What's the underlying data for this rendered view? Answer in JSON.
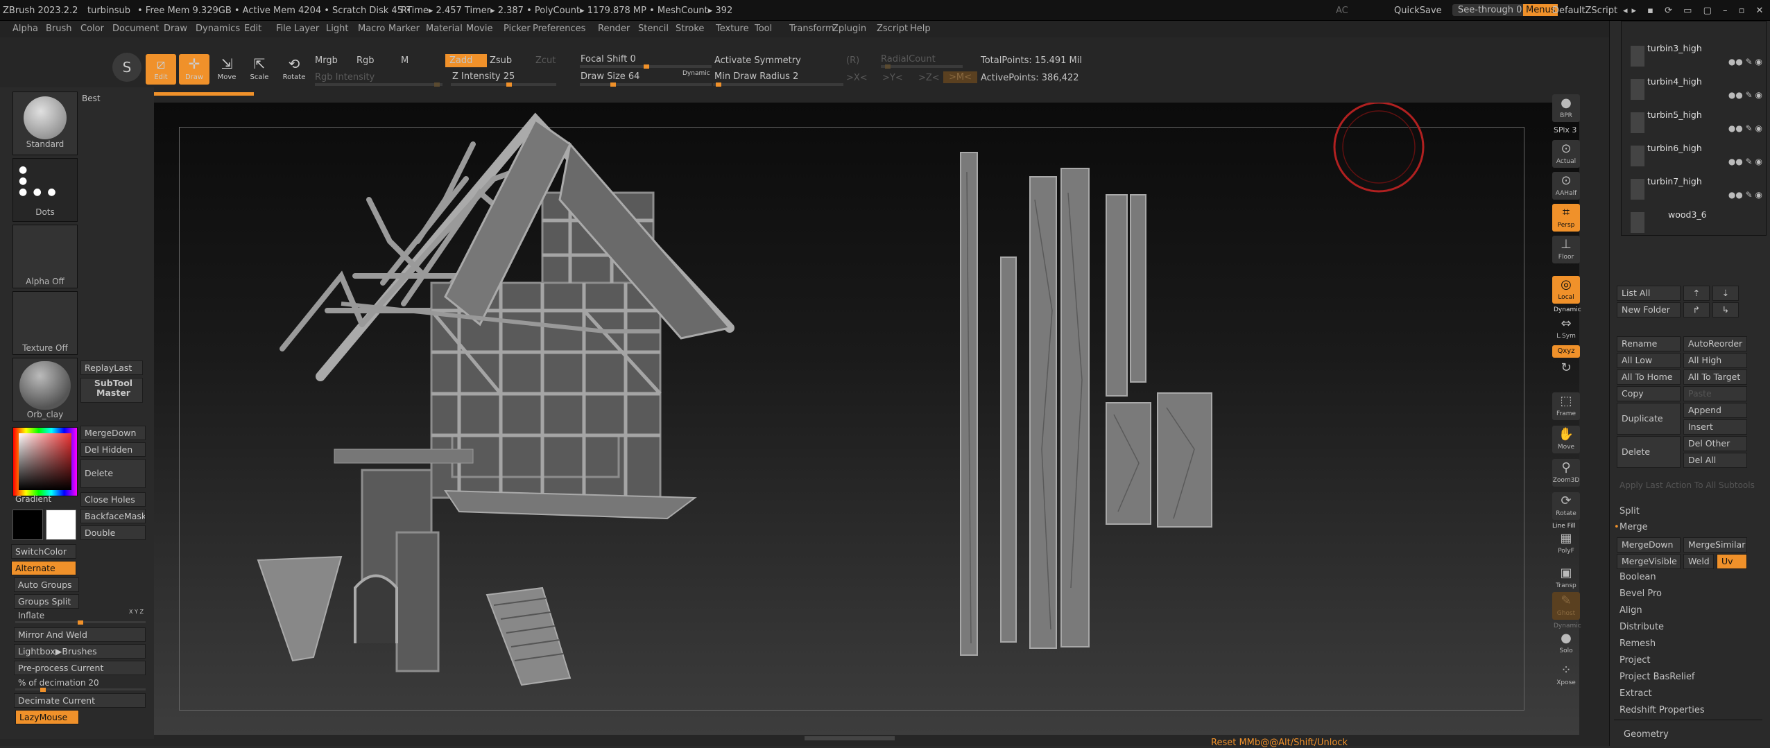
{
  "title": {
    "app": "ZBrush 2023.2.2",
    "doc": "turbinsub",
    "stats": "• Free Mem 9.329GB • Active Mem 4204 • Scratch Disk 45 •",
    "timer": "RTime▸ 2.457 Timer▸ 2.387 • PolyCount▸ 1179.878 MP • MeshCount▸ 392",
    "ac": "AC",
    "quicksave": "QuickSave",
    "seethrough": "See-through  0",
    "menus": "Menus",
    "script": "DefaultZScript"
  },
  "menus": [
    "Alpha",
    "Brush",
    "Color",
    "Document",
    "Draw",
    "Dynamics",
    "Edit",
    "File",
    "Layer",
    "Light",
    "Macro",
    "Marker",
    "Material",
    "Movie",
    "Picker",
    "Preferences",
    "Render",
    "Stencil",
    "Stroke",
    "Texture",
    "Tool",
    "Transform",
    "Zplugin",
    "Zscript",
    "Help"
  ],
  "toolbar": {
    "edit": "Edit",
    "draw": "Draw",
    "move": "Move",
    "scale": "Scale",
    "rotate": "Rotate",
    "mrgb": "Mrgb",
    "rgb": "Rgb",
    "m": "M",
    "rgb_intensity": "Rgb Intensity",
    "zadd": "Zadd",
    "zsub": "Zsub",
    "zcut": "Zcut",
    "z_intensity": "Z Intensity 25",
    "focal_shift": "Focal Shift 0",
    "draw_size": "Draw Size 64",
    "dynamic": "Dynamic",
    "activate_symmetry": "Activate Symmetry",
    "r": "(R)",
    "min_draw_radius": "Min Draw Radius 2",
    "x": ">X<",
    "y": ">Y<",
    "z": ">Z<",
    "m2": ">M<",
    "radial_count": "RadialCount",
    "total_points": "TotalPoints: 15.491 Mil",
    "active_points": "ActivePoints: 386,422"
  },
  "left": {
    "best": "Best",
    "standard": "Standard",
    "dots": "Dots",
    "alpha_off": "Alpha Off",
    "texture_off": "Texture Off",
    "material": "Orb_clay",
    "replay_last": "ReplayLast",
    "subtool_master": "SubTool Master",
    "merge_down": "MergeDown",
    "del_hidden": "Del Hidden",
    "delete": "Delete",
    "gradient": "Gradient",
    "close_holes": "Close Holes",
    "backface_mask": "BackfaceMask",
    "double": "Double",
    "switch_color": "SwitchColor",
    "alternate": "Alternate",
    "auto_groups": "Auto Groups",
    "groups_split": "Groups Split",
    "inflate": "Inflate",
    "xyz": "X Y Z",
    "mirror_weld": "Mirror And Weld",
    "lightbox_brushes": "Lightbox▶Brushes",
    "preprocess": "Pre-process Current",
    "decimation": "% of decimation 20",
    "decimate_current": "Decimate Current",
    "lazymouse": "LazyMouse"
  },
  "shelf": {
    "bpr": "BPR",
    "spix": "SPix 3",
    "actual": "Actual",
    "aahalf": "AAHalf",
    "persp": "Persp",
    "floor": "Floor",
    "local": "Local",
    "dynamic": "Dynamic",
    "lsym": "L.Sym",
    "qxyz": "Qxyz",
    "frame": "Frame",
    "move": "Move",
    "zoom3d": "Zoom3D",
    "rotate": "Rotate",
    "linefill": "Line Fill",
    "polyf": "PolyF",
    "transp": "Transp",
    "ghost": "Ghost",
    "dynamic2": "Dynamic",
    "solo": "Solo",
    "xpose": "Xpose"
  },
  "subtools": [
    "turbin3_high",
    "turbin4_high",
    "turbin5_high",
    "turbin6_high",
    "turbin7_high",
    "wood3_6"
  ],
  "subtool_btns": {
    "list_all": "List All",
    "new_folder": "New Folder",
    "rename": "Rename",
    "auto_reorder": "AutoReorder",
    "all_low": "All Low",
    "all_high": "All High",
    "all_to_home": "All To Home",
    "all_to_target": "All To Target",
    "copy": "Copy",
    "paste": "Paste",
    "duplicate": "Duplicate",
    "append": "Append",
    "insert": "Insert",
    "delete": "Delete",
    "del_other": "Del Other",
    "del_all": "Del All",
    "apply_last": "Apply Last Action To All Subtools",
    "split": "Split",
    "merge": "Merge",
    "merge_down": "MergeDown",
    "merge_similar": "MergeSimilar",
    "merge_visible": "MergeVisible",
    "weld": "Weld",
    "uv": "Uv",
    "boolean": "Boolean",
    "bevel_pro": "Bevel Pro",
    "align": "Align",
    "distribute": "Distribute",
    "remesh": "Remesh",
    "project": "Project",
    "project_basrelief": "Project BasRelief",
    "extract": "Extract",
    "redshift": "Redshift Properties",
    "geometry": "Geometry"
  },
  "status": "Reset MMb@@Alt/Shift/Unlock"
}
